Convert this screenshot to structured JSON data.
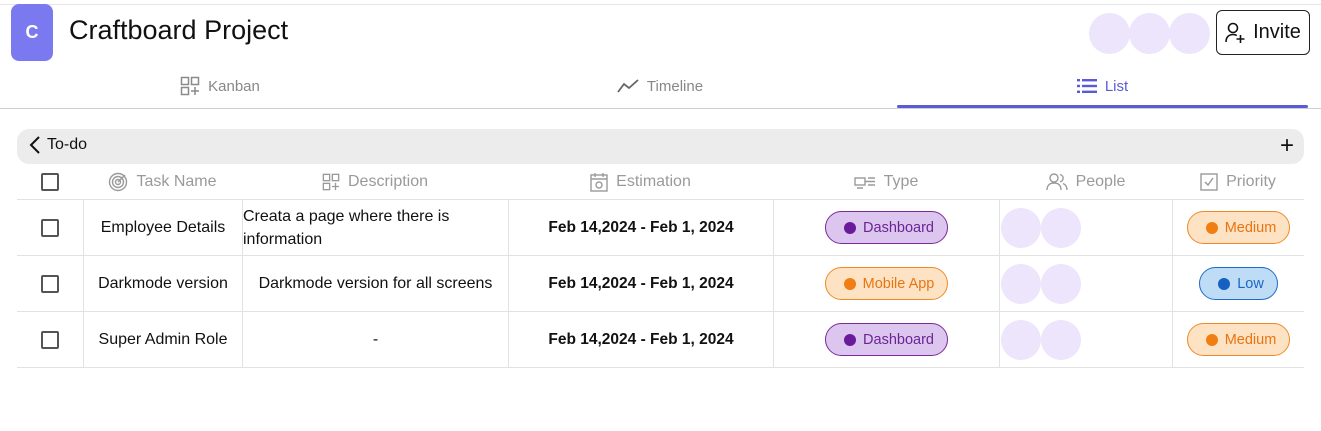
{
  "header": {
    "logo_letter": "C",
    "title": "Craftboard Project",
    "invite_label": "Invite",
    "avatar_count": 3
  },
  "tabs": [
    {
      "label": "Kanban",
      "icon": "kanban-icon",
      "active": false
    },
    {
      "label": "Timeline",
      "icon": "timeline-icon",
      "active": false
    },
    {
      "label": "List",
      "icon": "list-icon",
      "active": true
    }
  ],
  "group": {
    "label": "To-do",
    "add_symbol": "+"
  },
  "columns": {
    "task_name": "Task Name",
    "description": "Description",
    "estimation": "Estimation",
    "type": "Type",
    "people": "People",
    "priority": "Priority"
  },
  "rows": [
    {
      "task_name": "Employee Details",
      "description": "Creata a page where there is information",
      "estimation": "Feb 14,2024 - Feb 1, 2024",
      "type": "Dashboard",
      "priority": "Medium"
    },
    {
      "task_name": "Darkmode version",
      "description": "Darkmode version for all screens",
      "estimation": "Feb 14,2024 - Feb 1, 2024",
      "type": "Mobile App",
      "priority": "Low"
    },
    {
      "task_name": "Super Admin Role",
      "description": "-",
      "estimation": "Feb 14,2024 - Feb 1, 2024",
      "type": "Dashboard",
      "priority": "Medium"
    }
  ],
  "colors": {
    "accent": "#5b5bd6",
    "logo": "#7b79f0",
    "dashboard": "#6a1b9a",
    "mobile_app": "#f07e14",
    "medium": "#f07e14",
    "low": "#1560c0"
  }
}
